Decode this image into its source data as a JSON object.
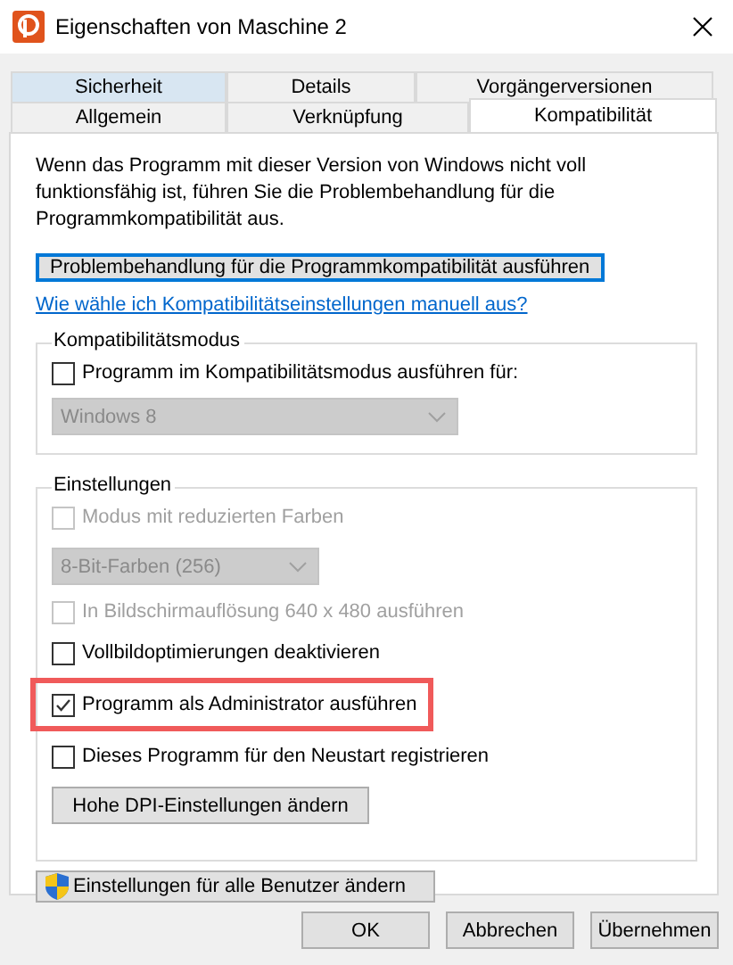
{
  "window": {
    "title": "Eigenschaften von Maschine 2"
  },
  "tab_rows": [
    {
      "tabs": [
        {
          "label": "Sicherheit",
          "selected": false,
          "hovered": true
        },
        {
          "label": "Details",
          "selected": false,
          "hovered": false
        },
        {
          "label": "Vorgängerversionen",
          "selected": false,
          "hovered": false
        }
      ]
    },
    {
      "tabs": [
        {
          "label": "Allgemein",
          "selected": false,
          "hovered": false
        },
        {
          "label": "Verknüpfung",
          "selected": false,
          "hovered": false
        },
        {
          "label": "Kompatibilität",
          "selected": true,
          "hovered": false
        }
      ]
    }
  ],
  "description": "Wenn das Programm mit dieser Version von Windows nicht voll funktionsfähig ist, führen Sie die Problembehandlung für die Programmkompatibilität aus.",
  "troubleshoot_button": {
    "label": "Problembehandlung für die Programmkompatibilität ausführen",
    "focused": true
  },
  "help_link": "Wie wähle ich Kompatibilitätseinstellungen manuell aus?",
  "groups": [
    {
      "title": "Kompatibilitätsmodus",
      "items": [
        {
          "kind": "checkbox",
          "label": "Programm im Kompatibilitätsmodus ausführen für:",
          "checked": false,
          "disabled": false,
          "highlighted": false
        },
        {
          "kind": "dropdown",
          "value": "Windows 8",
          "disabled": true
        }
      ]
    },
    {
      "title": "Einstellungen",
      "items": [
        {
          "kind": "checkbox",
          "label": "Modus mit reduzierten Farben",
          "checked": false,
          "disabled": true,
          "highlighted": false
        },
        {
          "kind": "dropdown",
          "value": "8-Bit-Farben (256)",
          "disabled": true
        },
        {
          "kind": "checkbox",
          "label": "In Bildschirmauflösung 640 x 480 ausführen",
          "checked": false,
          "disabled": true,
          "highlighted": false
        },
        {
          "kind": "checkbox",
          "label": "Vollbildoptimierungen deaktivieren",
          "checked": false,
          "disabled": false,
          "highlighted": false
        },
        {
          "kind": "checkbox",
          "label": "Programm als Administrator ausführen",
          "checked": true,
          "disabled": false,
          "highlighted": true
        },
        {
          "kind": "checkbox",
          "label": "Dieses Programm für den Neustart registrieren",
          "checked": false,
          "disabled": false,
          "highlighted": false
        },
        {
          "kind": "button",
          "label": "Hohe DPI-Einstellungen ändern"
        }
      ]
    }
  ],
  "all_users_button": {
    "label": "Einstellungen für alle Benutzer ändern"
  },
  "buttons": [
    {
      "label": "OK"
    },
    {
      "label": "Abbrechen"
    },
    {
      "label": "Übernehmen"
    }
  ]
}
